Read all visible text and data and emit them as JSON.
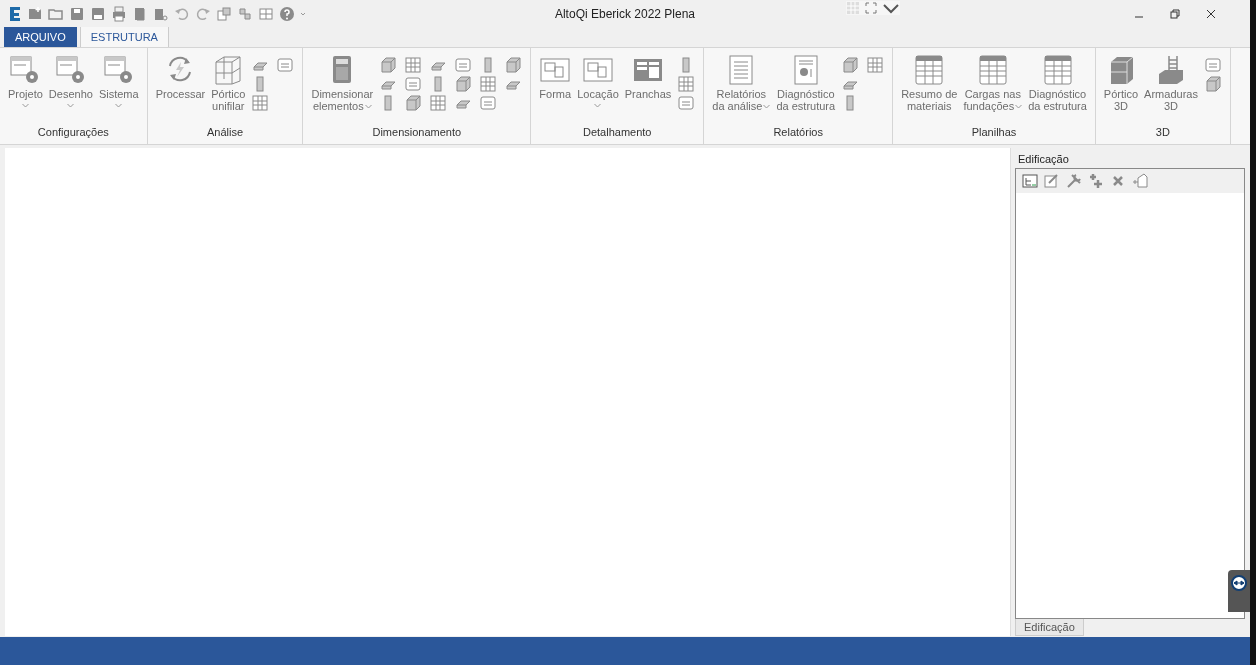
{
  "window": {
    "title": "AltoQi Eberick 2022 Plena"
  },
  "tabs": [
    {
      "label": "ARQUIVO",
      "kind": "file",
      "selected": false
    },
    {
      "label": "ESTRUTURA",
      "kind": "ribbon",
      "selected": true
    }
  ],
  "ribbon_groups": [
    {
      "label": "Configurações",
      "items": [
        {
          "kind": "large",
          "label": "Projeto",
          "dropdown": true
        },
        {
          "kind": "large",
          "label": "Desenho",
          "dropdown": true
        },
        {
          "kind": "large",
          "label": "Sistema",
          "dropdown": true
        }
      ]
    },
    {
      "label": "Análise",
      "items": [
        {
          "kind": "large",
          "label": "Processar",
          "dropdown": false
        },
        {
          "kind": "large",
          "label": "Pórtico\nunifilar",
          "dropdown": false
        },
        {
          "kind": "small"
        },
        {
          "kind": "small"
        },
        {
          "kind": "small"
        },
        {
          "kind": "small"
        }
      ]
    },
    {
      "label": "Dimensionamento",
      "items": [
        {
          "kind": "large",
          "label": "Dimensionar\nelementos",
          "dropdown": true
        },
        {
          "kind": "small"
        },
        {
          "kind": "small"
        },
        {
          "kind": "small"
        },
        {
          "kind": "small"
        },
        {
          "kind": "small"
        },
        {
          "kind": "small"
        },
        {
          "kind": "small"
        },
        {
          "kind": "small"
        },
        {
          "kind": "small"
        },
        {
          "kind": "small"
        },
        {
          "kind": "small"
        },
        {
          "kind": "small"
        },
        {
          "kind": "small"
        },
        {
          "kind": "small"
        },
        {
          "kind": "small"
        },
        {
          "kind": "small"
        },
        {
          "kind": "small"
        }
      ]
    },
    {
      "label": "Detalhamento",
      "items": [
        {
          "kind": "large",
          "label": "Forma",
          "dropdown": false
        },
        {
          "kind": "large",
          "label": "Locação",
          "dropdown": true
        },
        {
          "kind": "large",
          "label": "Pranchas",
          "dropdown": false
        },
        {
          "kind": "small"
        },
        {
          "kind": "small"
        },
        {
          "kind": "small"
        }
      ]
    },
    {
      "label": "Relatórios",
      "items": [
        {
          "kind": "large",
          "label": "Relatórios\nda análise",
          "dropdown": true
        },
        {
          "kind": "large",
          "label": "Diagnóstico\nda estrutura",
          "dropdown": false
        },
        {
          "kind": "small"
        },
        {
          "kind": "small"
        },
        {
          "kind": "small"
        },
        {
          "kind": "small"
        }
      ]
    },
    {
      "label": "Planilhas",
      "items": [
        {
          "kind": "large",
          "label": "Resumo de\nmateriais",
          "dropdown": false
        },
        {
          "kind": "large",
          "label": "Cargas nas\nfundações",
          "dropdown": true
        },
        {
          "kind": "large",
          "label": "Diagnóstico\nda estrutura",
          "dropdown": false
        }
      ]
    },
    {
      "label": "3D",
      "items": [
        {
          "kind": "large",
          "label": "Pórtico\n3D",
          "dropdown": false
        },
        {
          "kind": "large",
          "label": "Armaduras\n3D",
          "dropdown": false
        },
        {
          "kind": "small"
        },
        {
          "kind": "small"
        }
      ]
    }
  ],
  "side_panel": {
    "title": "Edificação",
    "tabs": [
      {
        "label": "Edificação"
      }
    ]
  }
}
